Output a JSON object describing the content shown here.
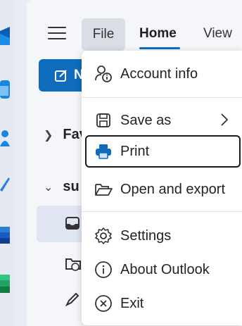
{
  "ribbon": {
    "tabs": [
      {
        "label": "File",
        "state": "open"
      },
      {
        "label": "Home",
        "state": "active"
      },
      {
        "label": "View",
        "state": "inactive"
      }
    ]
  },
  "compose": {
    "label": "N"
  },
  "navigation": {
    "favorites_label": "Fav",
    "account_label": "su"
  },
  "file_menu": {
    "items": [
      {
        "label": "Account info",
        "icon": "account-info-icon"
      },
      {
        "label": "Save as",
        "icon": "save-icon",
        "has_submenu": true
      },
      {
        "label": "Print",
        "icon": "print-icon",
        "focused": true
      },
      {
        "label": "Open and export",
        "icon": "folder-open-icon"
      },
      {
        "label": "Settings",
        "icon": "gear-icon"
      },
      {
        "label": "About Outlook",
        "icon": "info-icon"
      },
      {
        "label": "Exit",
        "icon": "close-circle-icon"
      }
    ]
  },
  "colors": {
    "accent": "#0f6cbd",
    "background": "#e9eef6",
    "menu_background": "#ffffff",
    "focus_border": "#1a1a1a"
  }
}
